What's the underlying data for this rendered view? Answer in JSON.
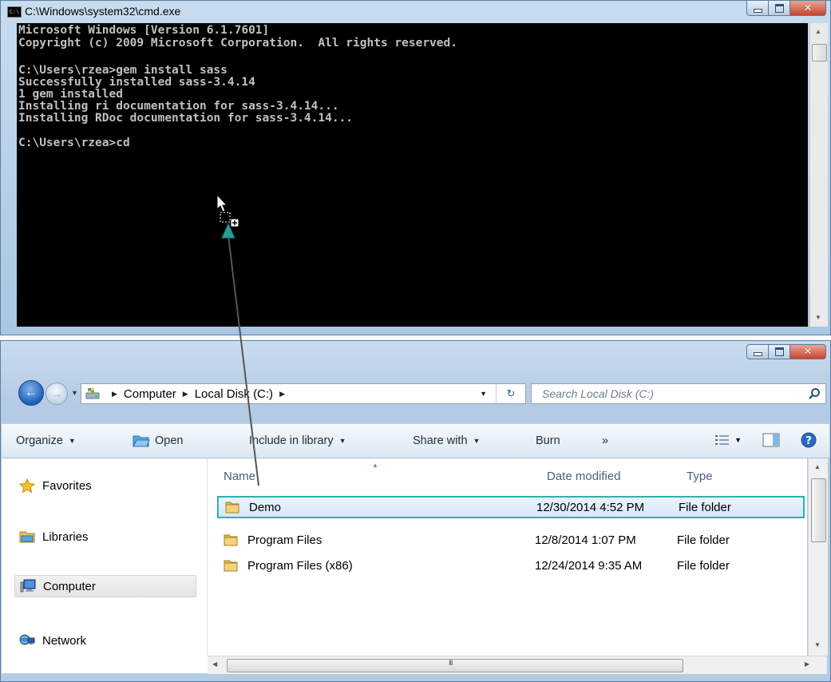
{
  "cmd": {
    "title": "C:\\Windows\\system32\\cmd.exe",
    "lines": [
      "Microsoft Windows [Version 6.1.7601]",
      "Copyright (c) 2009 Microsoft Corporation.  All rights reserved.",
      "",
      "C:\\Users\\rzea>gem install sass",
      "Successfully installed sass-3.4.14",
      "1 gem installed",
      "Installing ri documentation for sass-3.4.14...",
      "Installing RDoc documentation for sass-3.4.14...",
      "",
      "C:\\Users\\rzea>cd"
    ]
  },
  "explorer": {
    "breadcrumb": [
      "Computer",
      "Local Disk (C:)"
    ],
    "search_placeholder": "Search Local Disk (C:)",
    "toolbar": {
      "organize": "Organize",
      "open": "Open",
      "include": "Include in library",
      "share": "Share with",
      "burn": "Burn",
      "more": "»"
    },
    "nav": [
      {
        "label": "Favorites",
        "icon": "star-icon"
      },
      {
        "label": "Libraries",
        "icon": "libraries-icon"
      },
      {
        "label": "Computer",
        "icon": "computer-icon",
        "selected": true
      },
      {
        "label": "Network",
        "icon": "network-icon"
      }
    ],
    "columns": {
      "name": "Name",
      "date": "Date modified",
      "type": "Type"
    },
    "files": [
      {
        "name": "Demo",
        "date": "12/30/2014 4:52 PM",
        "type": "File folder",
        "selected": true
      },
      {
        "name": "Program Files",
        "date": "12/8/2014 1:07 PM",
        "type": "File folder"
      },
      {
        "name": "Program Files (x86)",
        "date": "12/24/2014 9:35 AM",
        "type": "File folder"
      }
    ],
    "hscroll_grip": "III"
  },
  "colors": {
    "selection_border": "#2fb2a9",
    "drag_arrow": "#555555",
    "drag_arrowhead": "#2a9e96"
  }
}
